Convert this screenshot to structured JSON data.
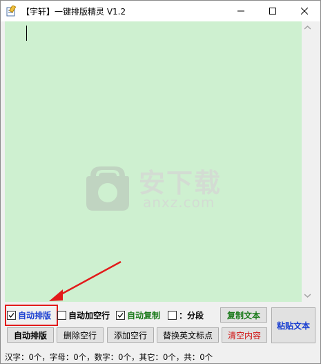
{
  "window": {
    "title": "【宇轩】一键排版精灵 V1.2",
    "controls": [
      "minimize",
      "maximize",
      "close"
    ]
  },
  "watermark": {
    "text": "安下载",
    "sub": "anxz.com"
  },
  "options": {
    "auto_layout": {
      "label": "自动排版",
      "checked": true,
      "color": "#1a3fd1"
    },
    "auto_blank_line": {
      "label": "自动加空行",
      "checked": false,
      "color": "#000000"
    },
    "auto_copy": {
      "label": "自动复制",
      "checked": true,
      "color": "#1a7a1a"
    },
    "segment": {
      "label": "：分段",
      "checked": false,
      "color": "#000000"
    }
  },
  "buttons": {
    "copy_text": "复制文本",
    "paste_text": "粘贴文本",
    "auto_layout": "自动排版",
    "delete_blank": "删除空行",
    "add_blank": "添加空行",
    "replace_punct": "替换英文标点",
    "clear": "清空内容"
  },
  "status": "汉字：0个，字母：0个，数字：0个，其它：0个，共：0个",
  "colors": {
    "editor_bg": "#cef0d0",
    "accent_red": "#e21a1a"
  }
}
